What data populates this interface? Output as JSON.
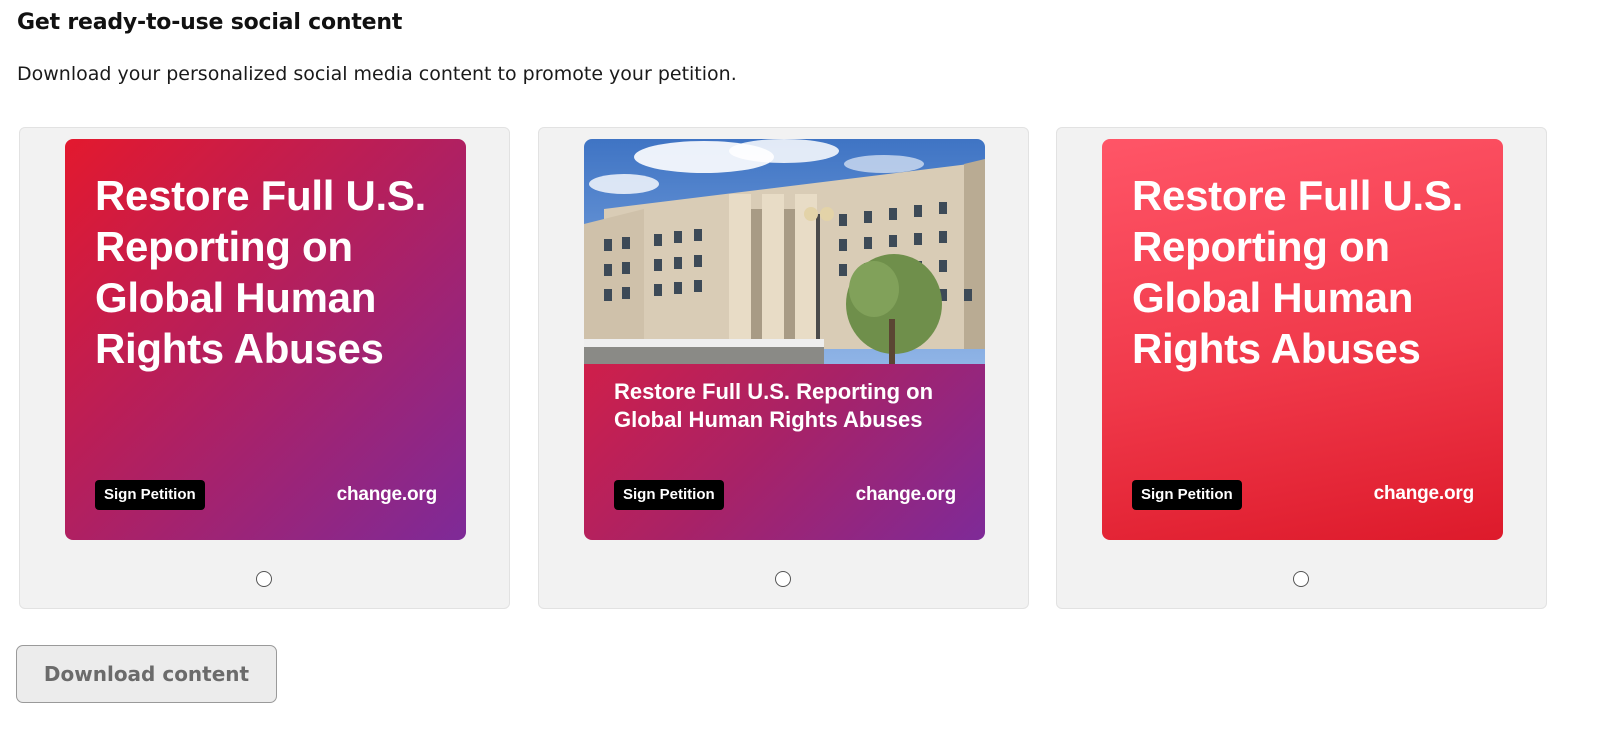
{
  "heading": "Get ready-to-use social content",
  "subtitle": "Download your personalized social media content to promote your petition.",
  "cards": [
    {
      "style": "gradient-purple",
      "title": "Restore Full U.S. Reporting on Global Human Rights Abuses",
      "button_label": "Sign Petition",
      "brand": "change.org",
      "selected": false
    },
    {
      "style": "photo-building",
      "title": "Restore Full U.S. Reporting on Global Human Rights Abuses",
      "button_label": "Sign Petition",
      "brand": "change.org",
      "selected": false
    },
    {
      "style": "gradient-red",
      "title": "Restore Full U.S. Reporting on Global Human Rights Abuses",
      "button_label": "Sign Petition",
      "brand": "change.org",
      "selected": false
    }
  ],
  "download_button": {
    "label": "Download content",
    "enabled": false
  },
  "colors": {
    "brand_red": "#e3192e",
    "brand_purple": "#7e2a98",
    "card_background": "#f2f2f2",
    "button_disabled_text": "#6b6b6b"
  }
}
